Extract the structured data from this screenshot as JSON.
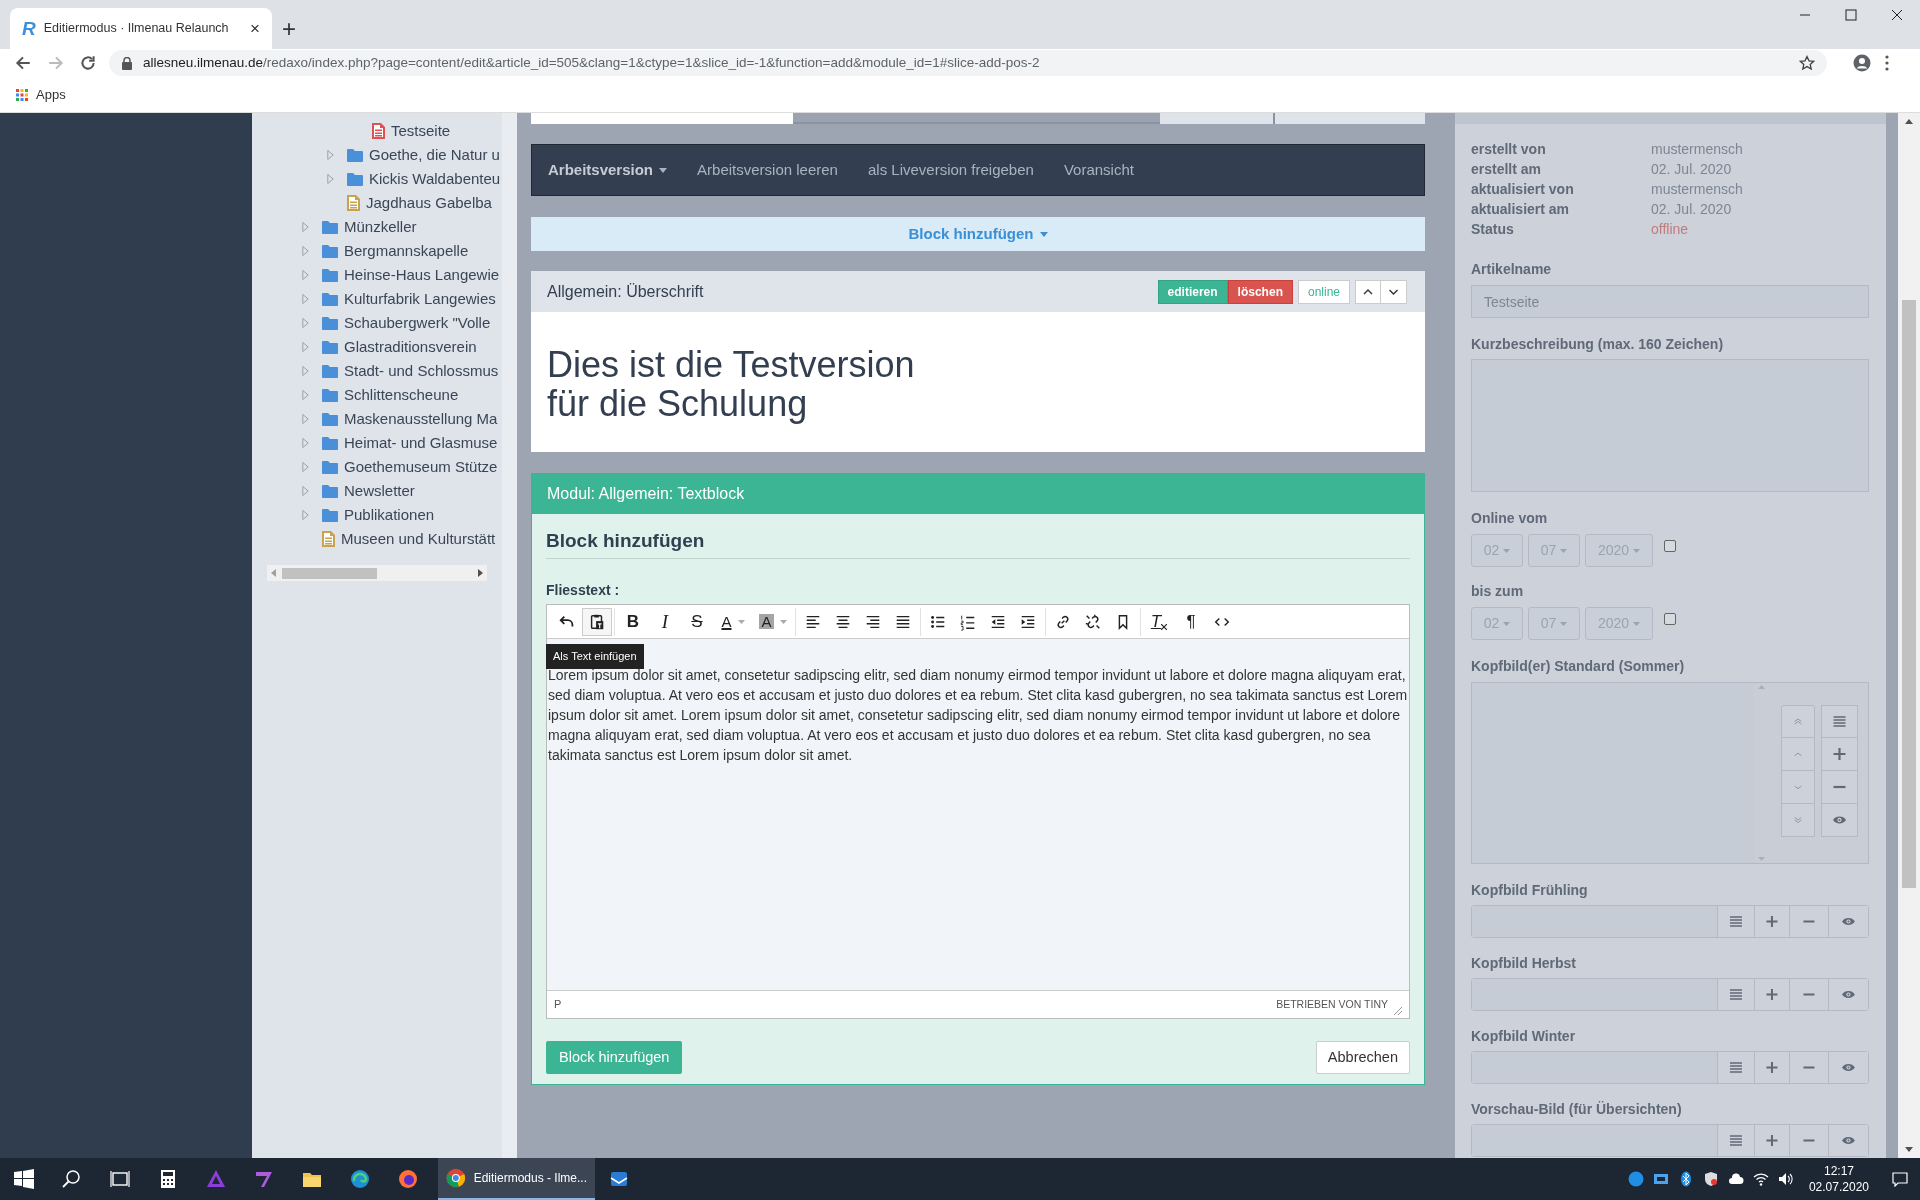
{
  "browser": {
    "tab": {
      "logo": "R",
      "title": "Editiermodus · Ilmenau Relaunch",
      "close": "×"
    },
    "new_tab": "+",
    "url_host": "allesneu.ilmenau.de",
    "url_path": "/redaxo/index.php?page=content/edit&article_id=505&clang=1&ctype=1&slice_id=-1&function=add&module_id=1#slice-add-pos-2",
    "bookmarks": [
      {
        "label": "Apps"
      }
    ]
  },
  "tree": [
    {
      "children": [
        {
          "children": [
            {
              "label": "Testseite",
              "kind": "page",
              "color": "#e05252"
            }
          ]
        },
        {
          "label": "Goethe, die Natur u",
          "kind": "folder"
        },
        {
          "label": "Kickis Waldabenteu",
          "kind": "folder"
        },
        {
          "label": "Jagdhaus Gabelba",
          "kind": "page",
          "color": "#c9a24e"
        }
      ]
    },
    {
      "label": "Münzkeller",
      "kind": "folder"
    },
    {
      "label": "Bergmannskapelle",
      "kind": "folder"
    },
    {
      "label": "Heinse-Haus Langewie",
      "kind": "folder"
    },
    {
      "label": "Kulturfabrik Langewies",
      "kind": "folder"
    },
    {
      "label": "Schaubergwerk \"Volle",
      "kind": "folder"
    },
    {
      "label": "Glastraditionsverein",
      "kind": "folder"
    },
    {
      "label": "Stadt- und Schlossmus",
      "kind": "folder"
    },
    {
      "label": "Schlittenscheune",
      "kind": "folder"
    },
    {
      "label": "Maskenausstellung Ma",
      "kind": "folder"
    },
    {
      "label": "Heimat- und Glasmuse",
      "kind": "folder"
    },
    {
      "label": "Goethemuseum Stütze",
      "kind": "folder"
    },
    {
      "label": "Newsletter",
      "kind": "folder"
    },
    {
      "label": "Publikationen",
      "kind": "folder"
    },
    {
      "label": "Museen und Kulturstätt",
      "kind": "page",
      "color": "#c9a24e"
    }
  ],
  "nav": [
    {
      "label": "Arbeitsversion",
      "dropdown": true,
      "selected": true
    },
    {
      "label": "Arbeitsversion leeren",
      "dropdown": false,
      "selected": false
    },
    {
      "label": "als Liveversion freigeben",
      "dropdown": false,
      "selected": false
    },
    {
      "label": "Voransicht",
      "dropdown": false,
      "selected": false
    }
  ],
  "add_block": {
    "label": "Block hinzufügen"
  },
  "slice": {
    "title": "Allgemein: Überschrift",
    "actions": [
      {
        "label": "editieren",
        "kind": "edit"
      },
      {
        "label": "löschen",
        "kind": "delete"
      },
      {
        "label": "online",
        "kind": "status"
      }
    ],
    "heading_lines": [
      "Dies ist die Testversion",
      "für die Schulung"
    ]
  },
  "module": {
    "title": "Modul: Allgemein: Textblock",
    "heading": "Block hinzufügen",
    "field_label": "Fliesstext :",
    "editor": {
      "toolbar": [
        [
          {
            "kind": "undo"
          },
          {
            "kind": "paste_text",
            "active": true
          }
        ],
        [
          {
            "kind": "bold",
            "label": "B"
          },
          {
            "kind": "italic",
            "label": "I"
          },
          {
            "kind": "strike",
            "label": "S"
          },
          {
            "kind": "text_color",
            "label": "A"
          },
          {
            "kind": "bg_color",
            "label": "A"
          }
        ],
        [
          {
            "kind": "align_left"
          },
          {
            "kind": "align_center"
          },
          {
            "kind": "align_right"
          },
          {
            "kind": "justify"
          }
        ],
        [
          {
            "kind": "bullet_list"
          },
          {
            "kind": "numbered_list"
          },
          {
            "kind": "outdent"
          },
          {
            "kind": "indent"
          }
        ],
        [
          {
            "kind": "link"
          },
          {
            "kind": "unlink"
          },
          {
            "kind": "bookmark"
          }
        ],
        [
          {
            "kind": "clear_format",
            "label": "T"
          },
          {
            "kind": "pilcrow",
            "label": "¶"
          },
          {
            "kind": "code"
          }
        ]
      ],
      "tooltip": "Als Text einfügen",
      "content": "Lorem ipsum dolor sit amet, consetetur sadipscing elitr, sed diam nonumy eirmod tempor invidunt ut labore et dolore magna aliquyam erat, sed diam voluptua. At vero eos et accusam et justo duo dolores et ea rebum. Stet clita kasd gubergren, no sea takimata sanctus est Lorem ipsum dolor sit amet. Lorem ipsum dolor sit amet, consetetur sadipscing elitr, sed diam nonumy eirmod tempor invidunt ut labore et dolore magna aliquyam erat, sed diam voluptua. At vero eos et accusam et justo duo dolores et ea rebum. Stet clita kasd gubergren, no sea takimata sanctus est Lorem ipsum dolor sit amet.",
      "status_path": "P",
      "branding": "BETRIEBEN VON TINY"
    },
    "buttons": [
      {
        "label": "Block hinzufügen",
        "kind": "primary"
      },
      {
        "label": "Abbrechen",
        "kind": "default"
      }
    ]
  },
  "meta": [
    {
      "label": "erstellt von",
      "value": "mustermensch",
      "kind": "text"
    },
    {
      "label": "erstellt am",
      "value": "02. Jul. 2020",
      "kind": "text"
    },
    {
      "label": "aktualisiert von",
      "value": "mustermensch",
      "kind": "text"
    },
    {
      "label": "aktualisiert am",
      "value": "02. Jul. 2020",
      "kind": "text"
    },
    {
      "label": "Status",
      "value": "offline",
      "kind": "status"
    }
  ],
  "article_name": {
    "label": "Artikelname",
    "value": "Testseite"
  },
  "short_description": {
    "label": "Kurzbeschreibung (max. 160 Zeichen)"
  },
  "date_ranges": [
    {
      "label": "Online vom",
      "day": "02",
      "month": "07",
      "year": "2020",
      "checked": false
    },
    {
      "label": "bis zum",
      "day": "02",
      "month": "07",
      "year": "2020",
      "checked": false
    }
  ],
  "media_list": {
    "label": "Kopfbild(er) Standard (Sommer)"
  },
  "media_fields": [
    {
      "label": "Kopfbild Frühling"
    },
    {
      "label": "Kopfbild Herbst"
    },
    {
      "label": "Kopfbild Winter"
    },
    {
      "label": "Vorschau-Bild (für Übersichten)"
    }
  ],
  "taskbar": {
    "active_app": "Editiermodus - Ilme...",
    "time": "12:17",
    "date": "02.07.2020"
  }
}
